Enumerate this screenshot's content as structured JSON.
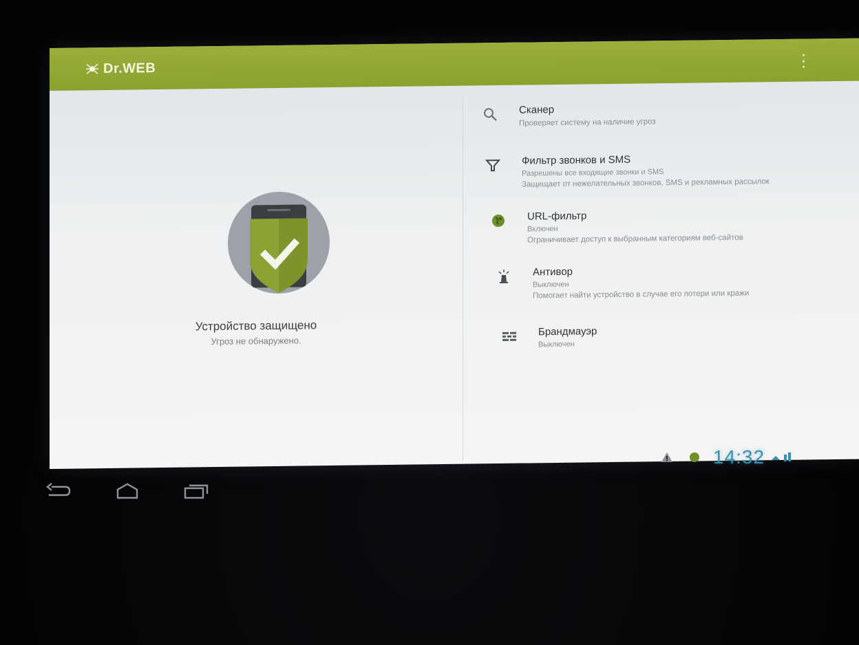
{
  "app": {
    "logo_text": "Dr.WEB"
  },
  "status": {
    "title": "Устройство защищено",
    "subtitle": "Угроз не обнаружено."
  },
  "features": [
    {
      "id": "scanner",
      "name": "Сканер",
      "state": "",
      "description": "Проверяет систему на наличие угроз",
      "icon": "search-icon"
    },
    {
      "id": "call-sms-filter",
      "name": "Фильтр звонков и SMS",
      "state": "Разрешены все входящие звонки и SMS",
      "description": "Защищает от нежелательных звонков, SMS и рекламных рассылок",
      "icon": "funnel-icon"
    },
    {
      "id": "url-filter",
      "name": "URL-фильтр",
      "state": "Включен",
      "description": "Ограничивает доступ к выбранным категориям веб-сайтов",
      "icon": "globe-icon"
    },
    {
      "id": "anti-theft",
      "name": "Антивор",
      "state": "Выключен",
      "description": "Помогает найти устройство в случае его потери или кражи",
      "icon": "beacon-icon"
    },
    {
      "id": "firewall",
      "name": "Брандмауэр",
      "state": "Выключен",
      "description": "",
      "icon": "brick-wall-icon"
    }
  ],
  "system": {
    "clock": "14:32"
  },
  "colors": {
    "brand_green": "#8ca22e",
    "shield_green": "#8aa334",
    "clock_blue": "#3a8fb0"
  }
}
